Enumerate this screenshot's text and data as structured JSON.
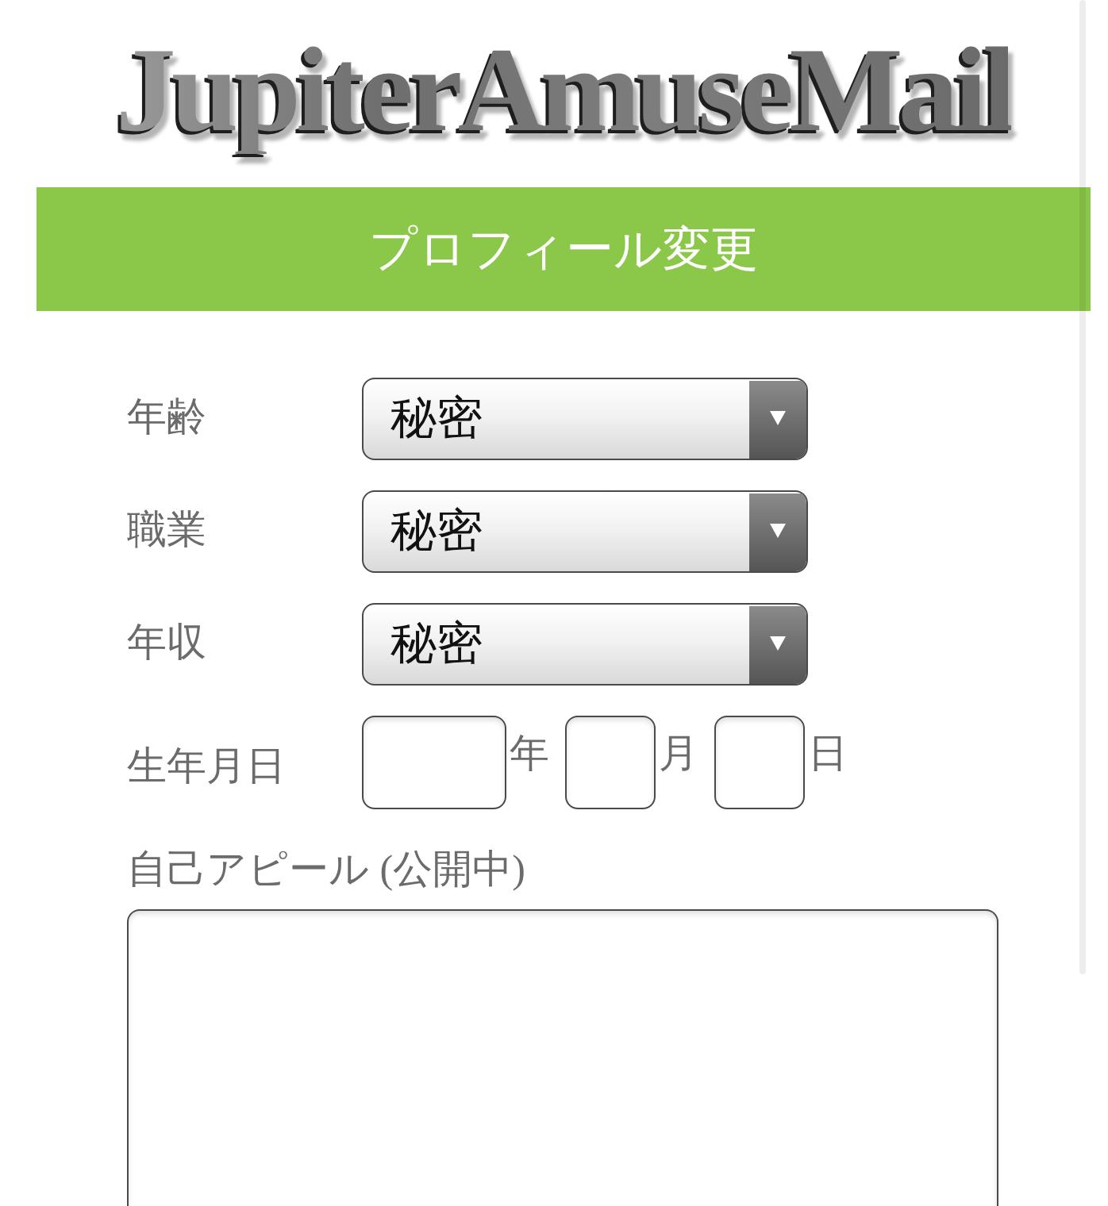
{
  "logo": {
    "text": "JupiterAmuseMail"
  },
  "header": {
    "title": "プロフィール変更"
  },
  "fields": [
    {
      "kind": "select",
      "label": "年齢",
      "value": "秘密"
    },
    {
      "kind": "select",
      "label": "職業",
      "value": "秘密"
    },
    {
      "kind": "select",
      "label": "年収",
      "value": "秘密"
    },
    {
      "kind": "date",
      "label": "生年月日",
      "parts": [
        {
          "unit": "年"
        },
        {
          "unit": "月"
        },
        {
          "unit": "日"
        }
      ]
    }
  ],
  "appeal": {
    "label": "自己アピール (公開中)"
  }
}
